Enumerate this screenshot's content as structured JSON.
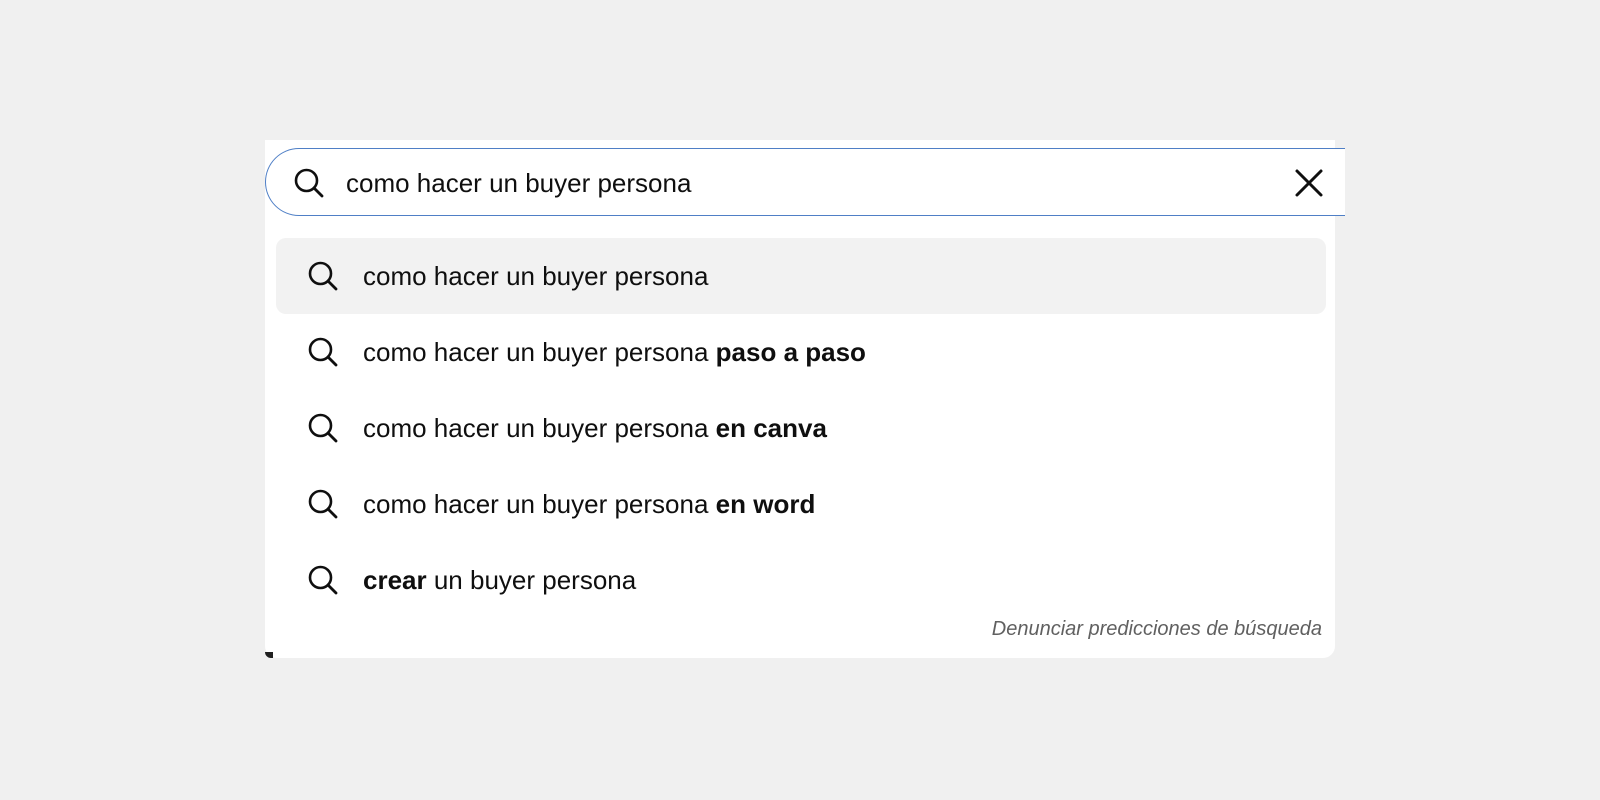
{
  "search": {
    "query": "como hacer un buyer persona",
    "clear_icon": "close-icon",
    "search_icon": "search-icon",
    "border_color": "#4f7fc6"
  },
  "suggestions": [
    {
      "normal": "como hacer un buyer persona",
      "bold": "",
      "prefix_bold": "",
      "active": true
    },
    {
      "normal": "como hacer un buyer persona ",
      "bold": "paso a paso",
      "prefix_bold": "",
      "active": false
    },
    {
      "normal": "como hacer un buyer persona ",
      "bold": "en canva",
      "prefix_bold": "",
      "active": false
    },
    {
      "normal": "como hacer un buyer persona ",
      "bold": "en word",
      "prefix_bold": "",
      "active": false
    },
    {
      "normal": " un buyer persona",
      "bold": "",
      "prefix_bold": "crear",
      "active": false
    }
  ],
  "footer": {
    "report_label": "Denunciar predicciones de búsqueda"
  },
  "colors": {
    "background": "#f0f0f0",
    "panel": "#ffffff",
    "active_row": "#f2f2f2",
    "text": "#0f0f0f",
    "muted": "#606060"
  }
}
